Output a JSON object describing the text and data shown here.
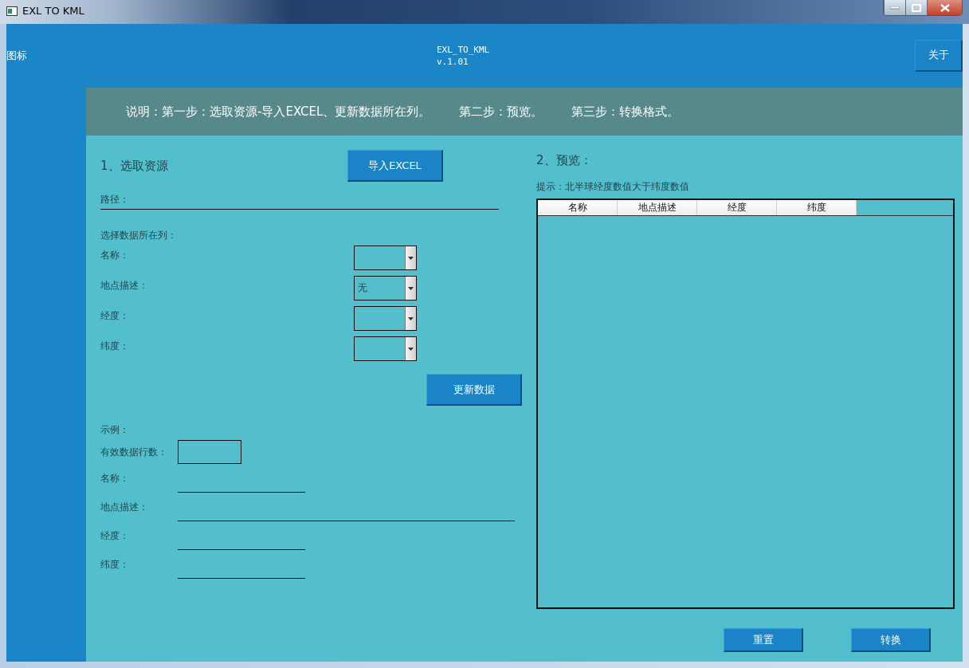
{
  "window": {
    "title": "EXL TO KML"
  },
  "header": {
    "icon_label": "图标",
    "app_name": "EXL_TO_KML",
    "version": "v.1.01",
    "about_button": "关于"
  },
  "instructions": [
    "说明：第一步：选取资源-导入EXCEL、更新数据所在列。",
    "第二步：预览。",
    "第三步：转换格式。"
  ],
  "source": {
    "heading": "1、选取资源",
    "import_button": "导入EXCEL",
    "path_label": "路径：",
    "columns_label": "选择数据所在列：",
    "columns": [
      {
        "label": "名称："
      },
      {
        "label": "地点描述：",
        "value": "无"
      },
      {
        "label": "经度："
      },
      {
        "label": "纬度："
      }
    ],
    "update_button": "更新数据"
  },
  "sample": {
    "heading": "示例：",
    "row_count_label": "有效数据行数：",
    "fields": [
      {
        "label": "名称：",
        "wide": false
      },
      {
        "label": "地点描述：",
        "wide": true
      },
      {
        "label": "经度：",
        "wide": false
      },
      {
        "label": "纬度：",
        "wide": false
      }
    ]
  },
  "preview": {
    "heading": "2、预览：",
    "hint": "提示：北半球经度数值大于纬度数值",
    "table": {
      "columns": [
        "名称",
        "地点描述",
        "经度",
        "纬度"
      ]
    }
  },
  "actions": [
    "重置",
    "转换"
  ]
}
